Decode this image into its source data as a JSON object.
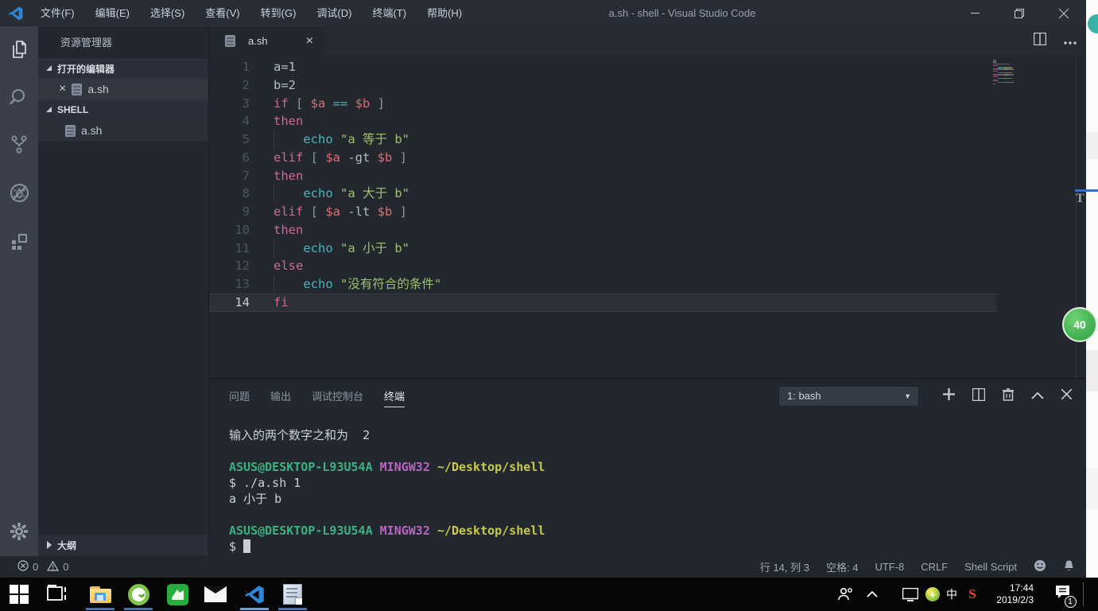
{
  "window": {
    "title": "a.sh - shell - Visual Studio Code"
  },
  "menus": [
    "文件(F)",
    "编辑(E)",
    "选择(S)",
    "查看(V)",
    "转到(G)",
    "调试(D)",
    "终端(T)",
    "帮助(H)"
  ],
  "activity_bar": [
    "explorer",
    "search",
    "source-control",
    "debug",
    "extensions",
    "settings"
  ],
  "sidebar": {
    "title": "资源管理器",
    "open_editors_label": "打开的编辑器",
    "open_editor_file": "a.sh",
    "folder_label": "SHELL",
    "folder_file": "a.sh",
    "outline_label": "大纲"
  },
  "tab": {
    "label": "a.sh"
  },
  "editor": {
    "lines": [
      [
        [
          "a=1",
          "t"
        ]
      ],
      [
        [
          "b=2",
          "t"
        ]
      ],
      [
        [
          "if ",
          "k"
        ],
        [
          "[ ",
          "p"
        ],
        [
          "$a ",
          "v"
        ],
        [
          "== ",
          "o"
        ],
        [
          "$b ",
          "v"
        ],
        [
          "]",
          "p"
        ]
      ],
      [
        [
          "then",
          "k"
        ]
      ],
      [
        [
          "    ",
          "t"
        ],
        [
          "echo ",
          "c"
        ],
        [
          "\"a 等于 b\"",
          "s"
        ]
      ],
      [
        [
          "elif ",
          "k"
        ],
        [
          "[ ",
          "p"
        ],
        [
          "$a ",
          "v"
        ],
        [
          "-gt ",
          "t"
        ],
        [
          "$b ",
          "v"
        ],
        [
          "]",
          "p"
        ]
      ],
      [
        [
          "then",
          "k"
        ]
      ],
      [
        [
          "    ",
          "t"
        ],
        [
          "echo ",
          "c"
        ],
        [
          "\"a 大于 b\"",
          "s"
        ]
      ],
      [
        [
          "elif ",
          "k"
        ],
        [
          "[ ",
          "p"
        ],
        [
          "$a ",
          "v"
        ],
        [
          "-lt ",
          "t"
        ],
        [
          "$b ",
          "v"
        ],
        [
          "]",
          "p"
        ]
      ],
      [
        [
          "then",
          "k"
        ]
      ],
      [
        [
          "    ",
          "t"
        ],
        [
          "echo ",
          "c"
        ],
        [
          "\"a 小于 b\"",
          "s"
        ]
      ],
      [
        [
          "else",
          "k"
        ]
      ],
      [
        [
          "    ",
          "t"
        ],
        [
          "echo ",
          "c"
        ],
        [
          "\"没有符合的条件\"",
          "s"
        ]
      ],
      [
        [
          "fi",
          "k"
        ]
      ]
    ],
    "current_line": 14
  },
  "panel": {
    "tabs": [
      "问题",
      "输出",
      "调试控制台",
      "终端"
    ],
    "active_tab": "终端",
    "dropdown_value": "1: bash",
    "terminal": [
      {
        "segs": [
          [
            "输入的两个数字之和为  2",
            "w"
          ]
        ]
      },
      {
        "segs": []
      },
      {
        "segs": [
          [
            "ASUS@DESKTOP-L93U54A ",
            "g"
          ],
          [
            "MINGW32 ",
            "m"
          ],
          [
            "~/Desktop/shell",
            "y"
          ]
        ]
      },
      {
        "segs": [
          [
            "$ ./a.sh 1",
            "w"
          ]
        ]
      },
      {
        "segs": [
          [
            "a 小于 b",
            "w"
          ]
        ]
      },
      {
        "segs": []
      },
      {
        "segs": [
          [
            "ASUS@DESKTOP-L93U54A ",
            "g"
          ],
          [
            "MINGW32 ",
            "m"
          ],
          [
            "~/Desktop/shell",
            "y"
          ]
        ]
      },
      {
        "segs": [
          [
            "$ ",
            "w"
          ]
        ],
        "cursor": true
      }
    ]
  },
  "statusbar": {
    "errors": "0",
    "warnings": "0",
    "line_col": "行 14, 列 3",
    "spaces": "空格: 4",
    "encoding": "UTF-8",
    "eol": "CRLF",
    "language": "Shell Script"
  },
  "taskbar": {
    "apps": [
      {
        "name": "start-button",
        "running": false
      },
      {
        "name": "task-view-button",
        "running": false
      },
      {
        "name": "file-explorer",
        "running": true
      },
      {
        "name": "browser-360",
        "running": true
      },
      {
        "name": "wps-office",
        "running": false
      },
      {
        "name": "mail",
        "running": false
      },
      {
        "name": "vscode",
        "running": true,
        "active": true
      },
      {
        "name": "notepad",
        "running": true
      }
    ],
    "ime_indicator": "中",
    "clock_time": "17:44",
    "clock_date": "2019/2/3",
    "notification_count": "1"
  },
  "overlay": {
    "speed_badge": "40"
  }
}
